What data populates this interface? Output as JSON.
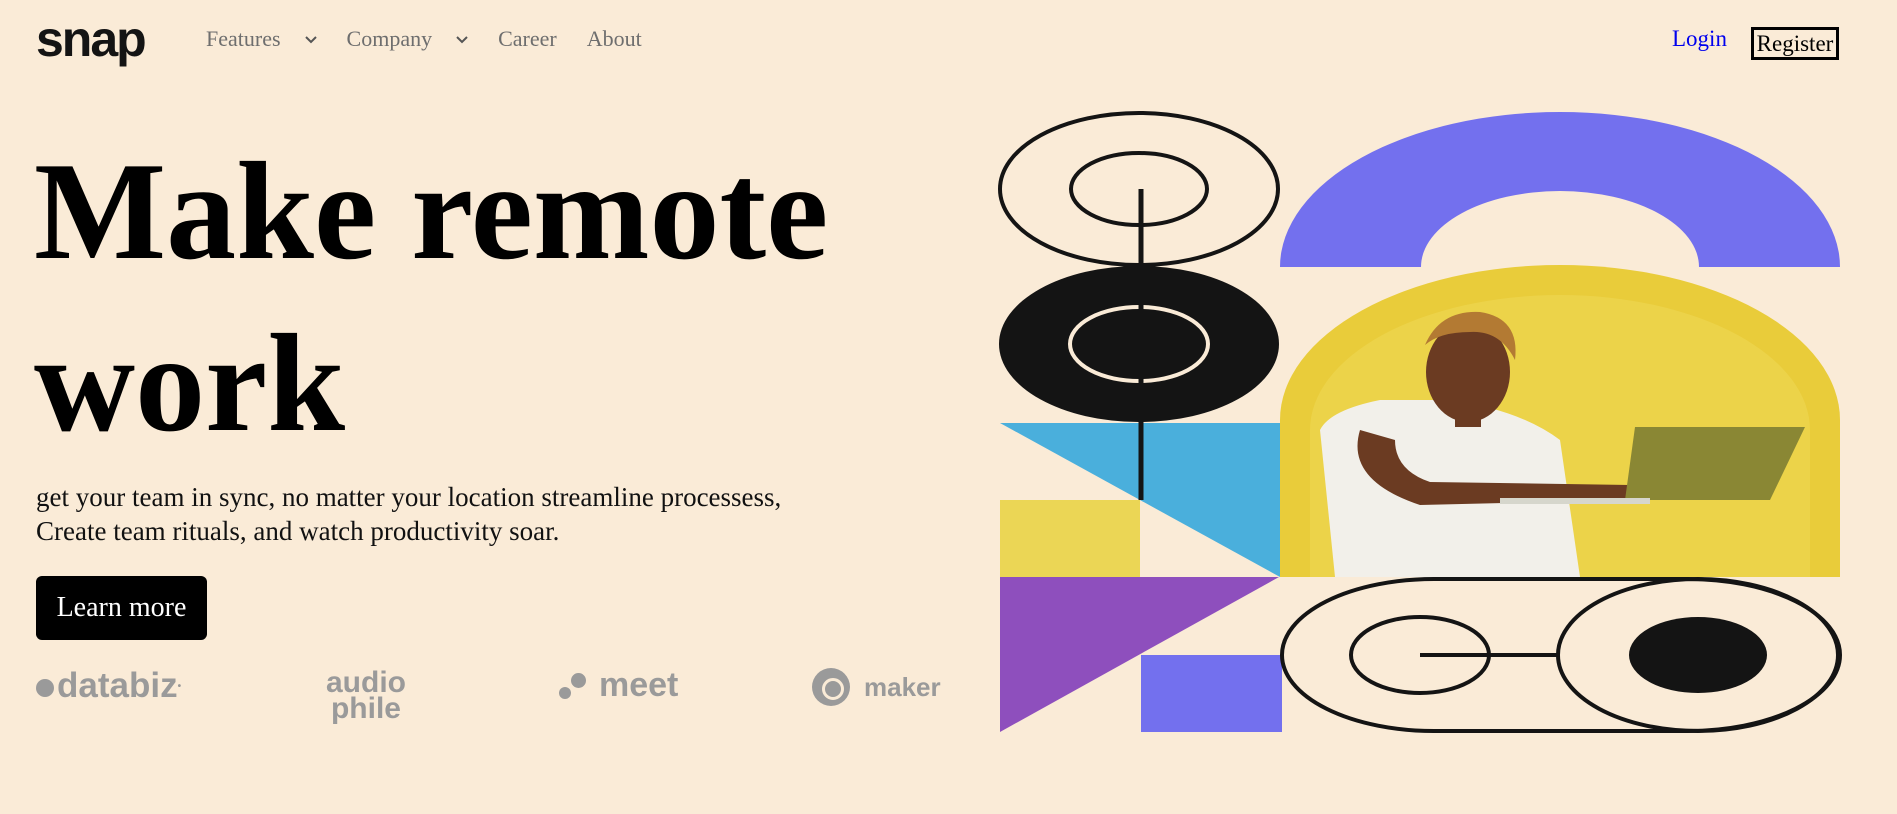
{
  "brand": {
    "logo_text": "snap"
  },
  "nav": {
    "items": [
      {
        "label": "Features",
        "has_dropdown": true
      },
      {
        "label": "Company",
        "has_dropdown": true
      },
      {
        "label": "Career",
        "has_dropdown": false
      },
      {
        "label": "About",
        "has_dropdown": false
      }
    ]
  },
  "auth": {
    "login_label": "Login",
    "register_label": "Register"
  },
  "hero": {
    "title": "Make remote work",
    "subtitle_line1": "get your team in sync, no matter your location streamline processess,",
    "subtitle_line2": "Create team rituals, and watch productivity soar.",
    "cta_label": "Learn more",
    "image_alt": "person using a laptop against a yellow wall"
  },
  "clients": [
    {
      "name": "databiz"
    },
    {
      "name_line1": "audio",
      "name_line2": "phile"
    },
    {
      "name": "meet"
    },
    {
      "name": "maker"
    }
  ],
  "colors": {
    "background": "#faebd7",
    "purple": "#7370ee",
    "blue": "#4aafdc",
    "yellow": "#ebd655",
    "violet": "#8e4fbd",
    "dark": "#141414"
  }
}
